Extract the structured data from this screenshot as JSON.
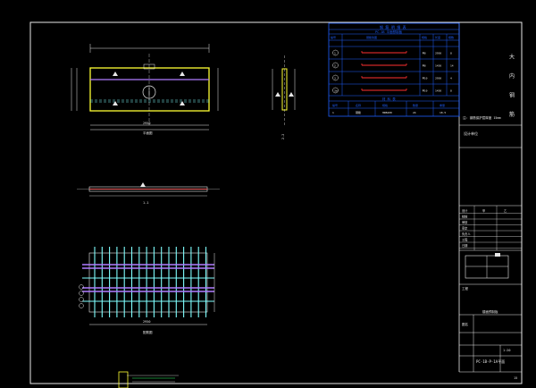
{
  "title_block": {
    "vertical_title": "大 内 钢 筋",
    "block_label": "设计单位",
    "sheet_no": "PC-1B-P-1A平面",
    "scale": "1:20",
    "page": "15",
    "rows": [
      "设计",
      "校核",
      "审核",
      "审定",
      "负责人",
      "工程",
      "日期"
    ],
    "row_values": [
      "甲",
      "乙"
    ],
    "project_label": "工程",
    "drawing_name": "楼面预制板",
    "drawing_label": "图名"
  },
  "table": {
    "title": "钢 筋 明 细 表",
    "subtitle": "PC-1B 平面预制板",
    "header": [
      "编号",
      "钢筋简图",
      "规格",
      "长度",
      "根数"
    ],
    "rows": [
      {
        "id": "1",
        "spec": "Φ8",
        "len": "2950",
        "n": "8"
      },
      {
        "id": "2",
        "spec": "Φ8",
        "len": "1450",
        "n": "14"
      },
      {
        "id": "3",
        "spec": "Φ10",
        "len": "2950",
        "n": "4"
      },
      {
        "id": "3a",
        "spec": "Φ10",
        "len": "1450",
        "n": "8"
      }
    ],
    "footer_title": "材 料 表",
    "footer_header": [
      "编号",
      "名称",
      "规格",
      "数量",
      "重量"
    ],
    "footer_row": [
      "1",
      "钢筋",
      "HRB400",
      "24",
      "18.5"
    ]
  },
  "views": {
    "plan_label": "平面图",
    "section_label": "1-1",
    "side_label": "2-2",
    "rebar_label": "配筋图",
    "plan_dim": "2950",
    "rebar_dim": "2950",
    "note": "注: 钢筋保护层厚度 15mm"
  },
  "colors": {
    "frame": "#e8e8e8",
    "slab": "#ffff33",
    "rebar": "#7fffff",
    "main_bar": "#b07cff",
    "cyan": "#00e5ff",
    "table": "#1f5fff",
    "red": "#ff3030",
    "green": "#33ff66"
  }
}
